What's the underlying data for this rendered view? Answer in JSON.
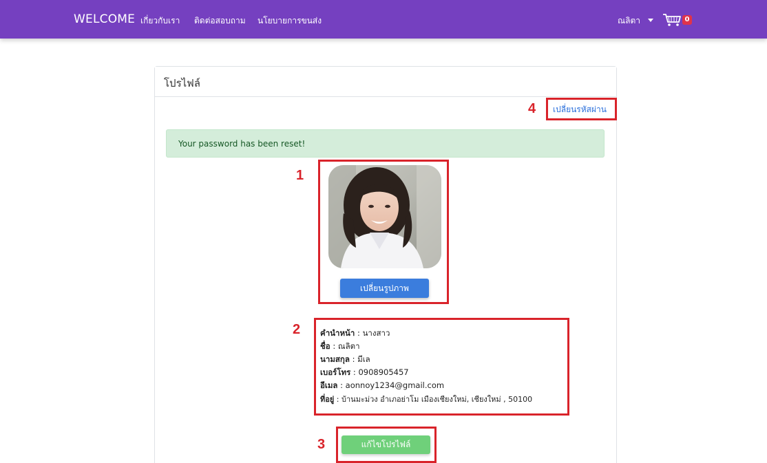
{
  "navbar": {
    "brand": "WELCOME",
    "links": [
      "เกี่ยวกับเรา",
      "ติดต่อสอบถาม",
      "นโยบายการขนส่ง"
    ],
    "user": "ณลิตา",
    "cart_count": "0",
    "color": "#7540c0"
  },
  "profile": {
    "title": "โปรไฟล์",
    "change_password": "เปลี่ยนรหัสผ่าน",
    "alert": "Your password has been reset!",
    "change_image": "เปลี่ยนรูปภาพ",
    "fields": [
      {
        "label": "คำนำหน้า",
        "value": "นางสาว"
      },
      {
        "label": "ชื่อ",
        "value": "ณลิตา"
      },
      {
        "label": "นามสกุล",
        "value": "มีเล"
      },
      {
        "label": "เบอร์โทร",
        "value": "0908905457"
      },
      {
        "label": "อีเมล",
        "value": "aonnoy1234@gmail.com"
      },
      {
        "label": "ที่อยู่",
        "value": "บ้านมะม่วง อำเภอย่าโม เมืองเชียงใหม่, เชียงใหม่ , 50100"
      }
    ],
    "edit_button": "แก้ไขโปรไฟล์"
  },
  "annotations": [
    "1",
    "2",
    "3",
    "4"
  ]
}
